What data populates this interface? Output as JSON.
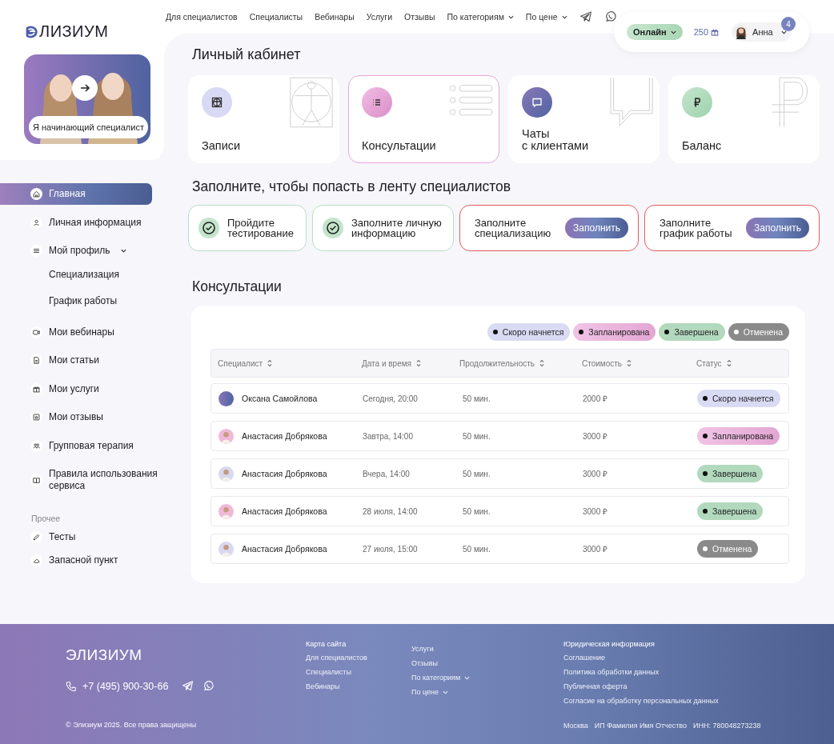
{
  "brand": {
    "logo_text": "ЛИЗИУМ",
    "banner_label": "Я начинающий специалист"
  },
  "topnav": [
    {
      "label": "Для специалистов",
      "has_menu": false
    },
    {
      "label": "Специалисты",
      "has_menu": false
    },
    {
      "label": "Вебинары",
      "has_menu": false
    },
    {
      "label": "Услуги",
      "has_menu": false
    },
    {
      "label": "Отзывы",
      "has_menu": false
    },
    {
      "label": "По категориям",
      "has_menu": true
    },
    {
      "label": "По цене",
      "has_menu": true
    }
  ],
  "account": {
    "status": "Онлайн",
    "bonus": "250",
    "name": "Анна",
    "notifications": "4"
  },
  "sidebar": {
    "items": [
      {
        "label": "Главная",
        "selected": true
      },
      {
        "label": "Личная информация",
        "selected": false
      },
      {
        "label": "Мой профиль",
        "selected": false,
        "expanded": true,
        "children": [
          {
            "label": "Специализация",
            "selected": false
          },
          {
            "label": "График работы",
            "selected": false
          }
        ]
      },
      {
        "label": "Мои вебинары",
        "selected": false
      },
      {
        "label": "Мои статьи",
        "selected": false
      },
      {
        "label": "Мои услуги",
        "selected": false
      },
      {
        "label": "Мои отзывы",
        "selected": false
      },
      {
        "label": "Групповая терапия",
        "selected": false
      },
      {
        "label": "Правила использования сервиса",
        "selected": false
      }
    ],
    "section_label": "Прочее",
    "other_items": [
      {
        "label": "Тесты",
        "selected": false
      },
      {
        "label": "Запасной пункт",
        "selected": false
      }
    ]
  },
  "page_title": "Личный кабинет",
  "cards": [
    {
      "label": "Записи",
      "selected": false
    },
    {
      "label": "Консультации",
      "selected": true
    },
    {
      "label": "Чаты\nс клиентами",
      "selected": false
    },
    {
      "label": "Баланс",
      "selected": false
    }
  ],
  "tasks_title": "Заполните, чтобы попасть в ленту специалистов",
  "tasks": [
    {
      "label": "Пройдите\nтестирование",
      "done": true
    },
    {
      "label": "Заполните личную\nинформацию",
      "done": true
    },
    {
      "label": "Заполните\nспециализацию",
      "done": false,
      "action": "Заполнить"
    },
    {
      "label": "Заполните\nграфик работы",
      "done": false,
      "action": "Заполнить"
    }
  ],
  "consultations": {
    "title": "Консультации",
    "legend": [
      {
        "label": "Скоро начнется",
        "kind": "soon"
      },
      {
        "label": "Запланирована",
        "kind": "planned"
      },
      {
        "label": "Завершена",
        "kind": "done"
      },
      {
        "label": "Отменена",
        "kind": "cancelled"
      }
    ],
    "columns": [
      "Специалист",
      "Дата и время",
      "Продолжительность",
      "Стоимость",
      "Статус"
    ],
    "rows": [
      {
        "specialist": "Оксана Самойлова",
        "datetime": "Сегодня, 20:00",
        "duration": "50 мин.",
        "cost": "2000 ₽",
        "status": "Скоро начнется",
        "kind": "soon"
      },
      {
        "specialist": "Анастасия Добрякова",
        "datetime": "Завтра, 14:00",
        "duration": "50 мин.",
        "cost": "3000 ₽",
        "status": "Запланирована",
        "kind": "planned"
      },
      {
        "specialist": "Анастасия Добрякова",
        "datetime": "Вчера, 14:00",
        "duration": "50 мин.",
        "cost": "3000 ₽",
        "status": "Завершена",
        "kind": "done"
      },
      {
        "specialist": "Анастасия Добрякова",
        "datetime": "28 июля, 14:00",
        "duration": "50 мин.",
        "cost": "3000 ₽",
        "status": "Завершена",
        "kind": "done"
      },
      {
        "specialist": "Анастасия Добрякова",
        "datetime": "27 июля, 15:00",
        "duration": "50 мин.",
        "cost": "3000 ₽",
        "status": "Отменена",
        "kind": "cancelled"
      }
    ]
  },
  "footer": {
    "logo": "ЭЛИЗИУМ",
    "phone": "+7 (495) 900-30-66",
    "copyright": "© Элизиум 2025. Все права защищены",
    "sitemap_title": "Карта сайта",
    "sitemap": [
      {
        "label": "Для специалистов",
        "has_menu": false
      },
      {
        "label": "Специалисты",
        "has_menu": false
      },
      {
        "label": "Вебинары",
        "has_menu": false
      }
    ],
    "sitemap_more": [
      {
        "label": "Услуги",
        "has_menu": false
      },
      {
        "label": "Отзывы",
        "has_menu": false
      },
      {
        "label": "По категориям",
        "has_menu": true
      },
      {
        "label": "По цене",
        "has_menu": true
      }
    ],
    "legal_title": "Юридическая информация",
    "legal": [
      "Соглашение",
      "Политика обработки данных",
      "Публичная оферта",
      "Согласие на обработку персональных данных"
    ],
    "details": [
      "Москва",
      "ИП Фамилия Имя Отчество",
      "ИНН: 780048273238"
    ]
  }
}
